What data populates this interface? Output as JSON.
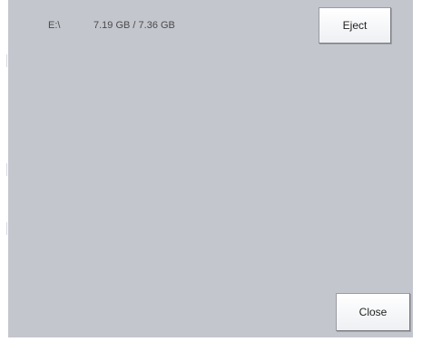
{
  "drive": {
    "letter": "E:\\",
    "usage": "7.19 GB / 7.36 GB"
  },
  "buttons": {
    "eject_label": "Eject",
    "close_label": "Close"
  },
  "colors": {
    "panel_background": "#c4c6ce",
    "button_face": "#ffffff",
    "text": "#4a4a4a"
  }
}
